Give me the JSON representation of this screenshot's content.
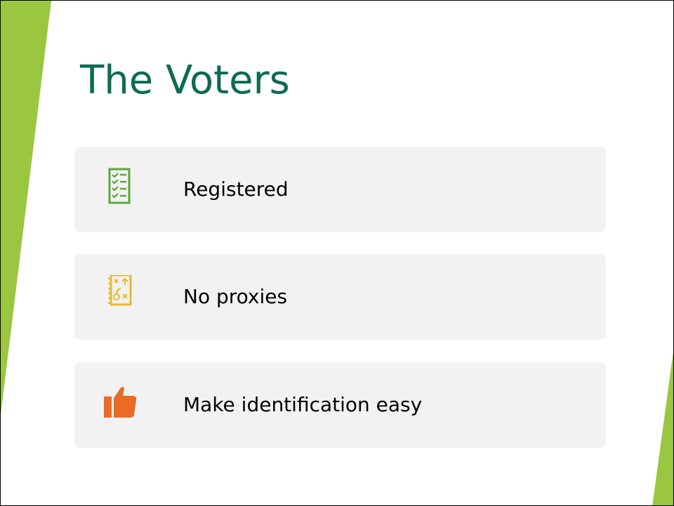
{
  "title": "The Voters",
  "items": [
    {
      "label": "Registered",
      "icon": "checklist-icon",
      "color": "#5aa83c"
    },
    {
      "label": "No proxies",
      "icon": "strategy-icon",
      "color": "#e8b92e"
    },
    {
      "label": "Make identification easy",
      "icon": "thumbs-up-icon",
      "color": "#ea6a26"
    }
  ],
  "colors": {
    "accent": "#9bc63f",
    "title": "#0e6b52",
    "card": "#f2f2f2"
  }
}
